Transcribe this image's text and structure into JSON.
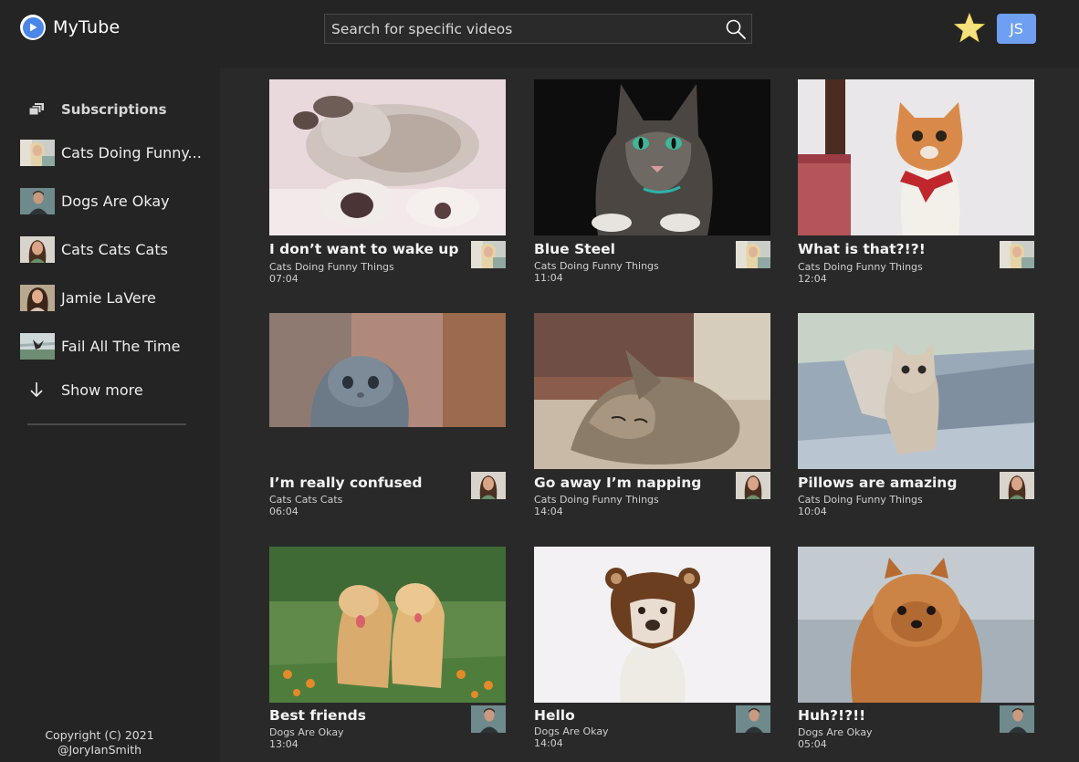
{
  "app": {
    "title": "MyTube"
  },
  "search": {
    "placeholder": "Search for specific videos"
  },
  "header": {
    "user_initials": "JS",
    "accent": "#6f9ff0"
  },
  "sidebar": {
    "subscriptions_label": "Subscriptions",
    "channels": [
      {
        "name": "Cats Doing Funny..."
      },
      {
        "name": "Dogs Are Okay"
      },
      {
        "name": "Cats Cats Cats"
      },
      {
        "name": "Jamie LaVere"
      },
      {
        "name": "Fail All The Time"
      }
    ],
    "show_more_label": "Show more",
    "copyright_line1": "Copyright (C) 2021",
    "copyright_line2": "@JoryIanSmith"
  },
  "videos": [
    {
      "title": "I don’t want to wake up",
      "channel": "Cats Doing Funny Things",
      "duration": "07:04"
    },
    {
      "title": "Blue Steel",
      "channel": "Cats Doing Funny Things",
      "duration": "11:04"
    },
    {
      "title": "What is that?!?!",
      "channel": "Cats Doing Funny Things",
      "duration": "12:04"
    },
    {
      "title": "I’m really confused",
      "channel": "Cats Cats Cats",
      "duration": "06:04"
    },
    {
      "title": "Go away I’m napping",
      "channel": "Cats Doing Funny Things",
      "duration": "14:04"
    },
    {
      "title": "Pillows are amazing",
      "channel": "Cats Doing Funny Things",
      "duration": "10:04"
    },
    {
      "title": "Best friends",
      "channel": "Dogs Are Okay",
      "duration": "13:04"
    },
    {
      "title": "Hello",
      "channel": "Dogs Are Okay",
      "duration": "14:04"
    },
    {
      "title": "Huh?!?!!",
      "channel": "Dogs Are Okay",
      "duration": "05:04"
    }
  ]
}
